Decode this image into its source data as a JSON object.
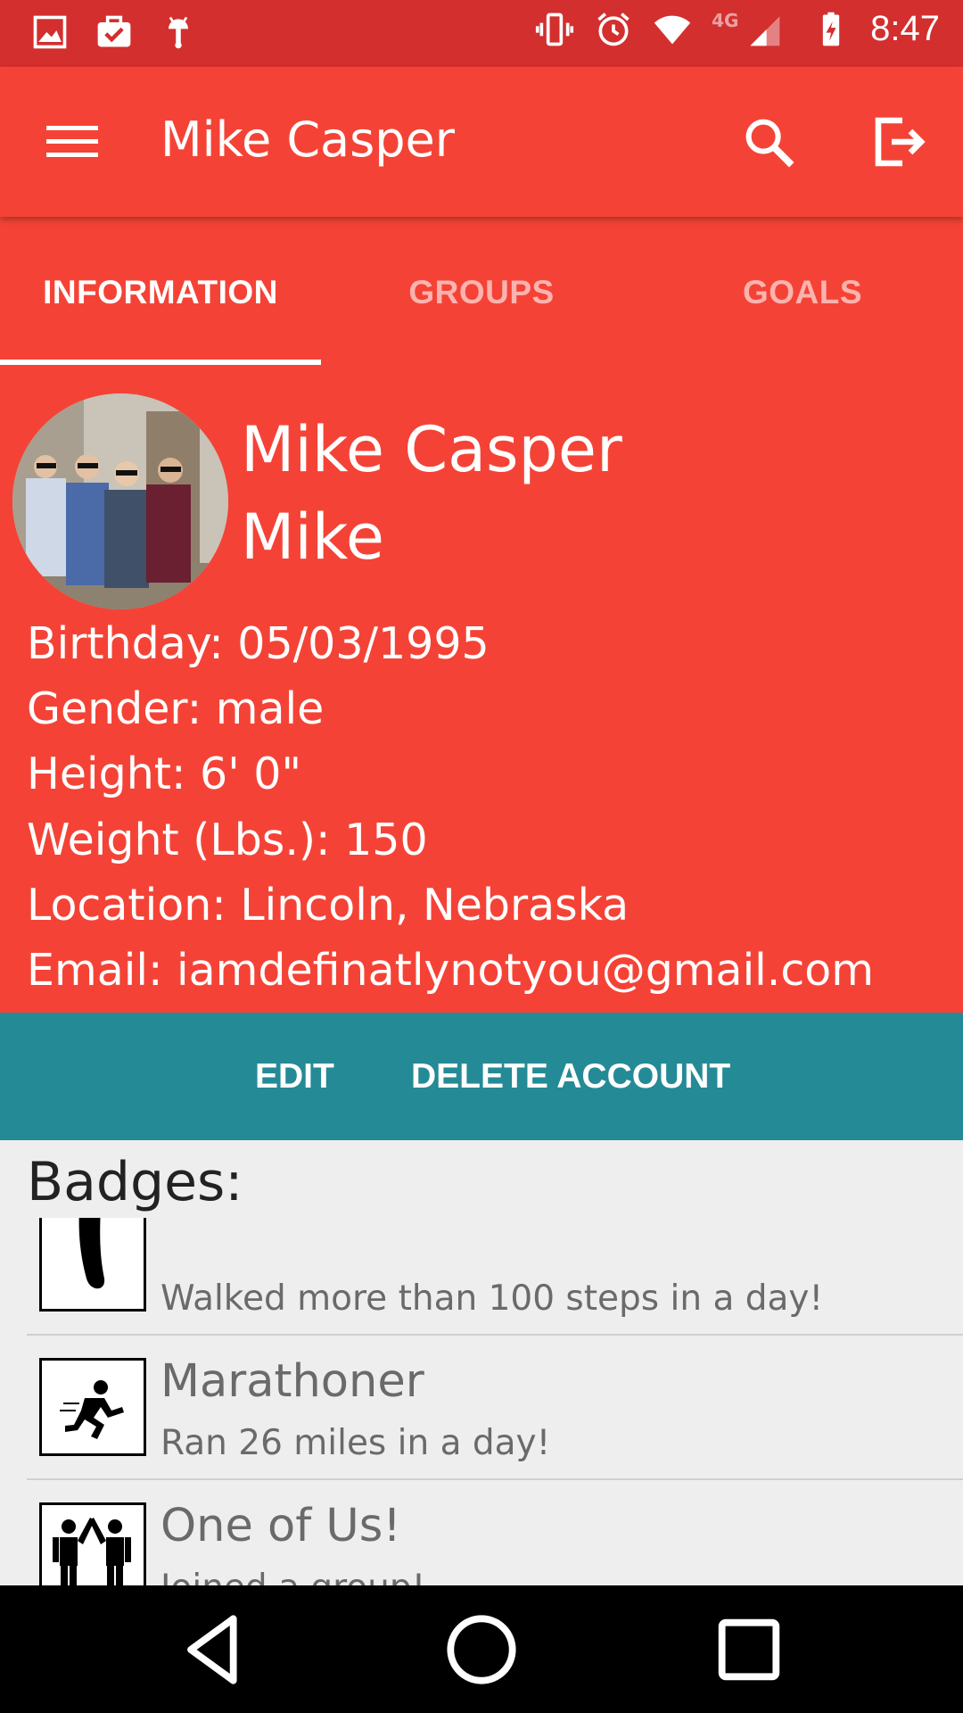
{
  "status_bar": {
    "time": "8:47",
    "left_icons": [
      "image-icon",
      "briefcase-check-icon",
      "android-icon"
    ],
    "right_icons": [
      "vibrate-icon",
      "alarm-icon",
      "wifi-icon",
      "signal-4g-icon",
      "battery-charging-icon"
    ],
    "network_label": "4G"
  },
  "app_bar": {
    "title": "Mike Casper",
    "icons": [
      "menu-icon",
      "search-icon",
      "logout-icon"
    ]
  },
  "tabs": [
    {
      "label": "INFORMATION",
      "active": true
    },
    {
      "label": "GROUPS",
      "active": false
    },
    {
      "label": "GOALS",
      "active": false
    }
  ],
  "profile": {
    "name": "Mike Casper",
    "nickname": "Mike",
    "birthday": "Birthday: 05/03/1995",
    "gender": "Gender: male",
    "height": "Height: 6'  0\"",
    "weight": "Weight (Lbs.): 150",
    "location": "Location: Lincoln, Nebraska",
    "email": "Email: iamdefinatlynotyou@gmail.com"
  },
  "actions": {
    "edit": "EDIT",
    "delete": "DELETE ACCOUNT"
  },
  "badges": {
    "title": "Badges:",
    "items": [
      {
        "name": "",
        "desc": "Walked more than 100 steps in a day!",
        "icon": "footprint-icon"
      },
      {
        "name": "Marathoner",
        "desc": "Ran 26 miles in a day!",
        "icon": "runner-icon"
      },
      {
        "name": "One of Us!",
        "desc": "Joined a group!",
        "icon": "high-five-icon"
      }
    ]
  },
  "nav_bar": {
    "icons": [
      "back-icon",
      "home-icon",
      "recents-icon"
    ]
  },
  "colors": {
    "status_bar": "#d32f2f",
    "primary": "#f44336",
    "accent_bar": "#248a96",
    "background": "#eeeeee"
  }
}
